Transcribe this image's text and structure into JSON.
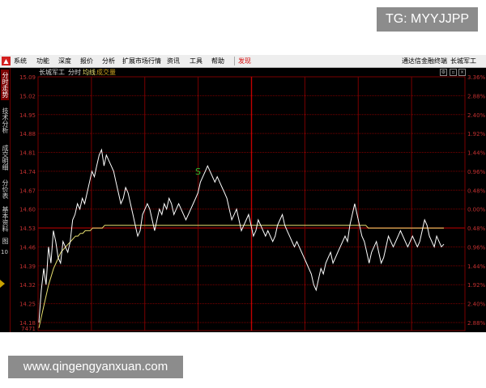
{
  "watermark_top": "TG: MYYJJPP",
  "watermark_bottom": "www.qingengyanxuan.com",
  "menu": {
    "items": [
      "系统",
      "功能",
      "深度",
      "报价",
      "分析",
      "扩展市场行情",
      "资讯",
      "工具",
      "帮助"
    ],
    "discover": "发现",
    "app_name": "通达信金融终端",
    "stock": "长城军工"
  },
  "sidebar": {
    "tabs": [
      "分时走势",
      "技术分析",
      "成交明细",
      "分价表",
      "基本资料",
      "图"
    ],
    "number": "10"
  },
  "chart_header": {
    "stock": "长城军工",
    "mode": "分时",
    "avg_label": "均线",
    "volume_label": "成交量"
  },
  "chart_data": {
    "type": "line",
    "y_labels": [
      "15.09",
      "15.02",
      "14.95",
      "14.88",
      "14.81",
      "14.74",
      "14.67",
      "14.60",
      "14.53",
      "14.46",
      "14.39",
      "14.32",
      "14.25",
      "14.18"
    ],
    "bottom_label": "7471",
    "pct_labels": [
      "3.36%",
      "2.88%",
      "2.40%",
      "1.92%",
      "1.44%",
      "0.96%",
      "0.48%",
      "0.00%",
      "0.48%",
      "0.96%",
      "1.44%",
      "1.92%",
      "2.40%",
      "2.88%"
    ],
    "ylim": [
      14.15,
      15.09
    ],
    "prev_close": 14.53,
    "annotation": "S",
    "colors": {
      "price": "#ffffff",
      "avg": "#e8e070",
      "grid": "#7a0000",
      "axis_text": "#c03030",
      "annotation": "#30c030"
    },
    "series": [
      {
        "values": [
          14.18,
          14.3,
          14.38,
          14.32,
          14.46,
          14.4,
          14.52,
          14.48,
          14.42,
          14.4,
          14.48,
          14.46,
          14.44,
          14.48,
          14.56,
          14.58,
          14.62,
          14.6,
          14.64,
          14.62,
          14.66,
          14.7,
          14.74,
          14.72,
          14.76,
          14.8,
          14.82,
          14.76,
          14.8,
          14.78,
          14.76,
          14.74,
          14.7,
          14.66,
          14.62,
          14.64,
          14.68,
          14.66,
          14.62,
          14.58,
          14.54,
          14.5,
          14.52,
          14.58,
          14.6,
          14.62,
          14.6,
          14.56,
          14.52,
          14.56,
          14.6,
          14.58,
          14.62,
          14.6,
          14.64,
          14.62,
          14.58,
          14.6,
          14.62,
          14.6,
          14.58,
          14.56,
          14.58,
          14.6,
          14.62,
          14.64,
          14.66,
          14.7,
          14.72,
          14.74,
          14.76,
          14.74,
          14.72,
          14.7,
          14.72,
          14.7,
          14.68,
          14.66,
          14.64,
          14.6,
          14.56,
          14.58,
          14.6,
          14.56,
          14.52,
          14.54,
          14.56,
          14.58,
          14.54,
          14.5,
          14.52,
          14.56,
          14.54,
          14.52,
          14.5,
          14.52,
          14.5,
          14.48,
          14.5,
          14.54,
          14.56,
          14.58,
          14.54,
          14.52,
          14.5,
          14.48,
          14.46,
          14.48,
          14.46,
          14.44,
          14.42,
          14.4,
          14.38,
          14.36,
          14.32,
          14.3,
          14.34,
          14.38,
          14.36,
          14.4,
          14.42,
          14.44,
          14.4,
          14.42,
          14.44,
          14.46,
          14.48,
          14.5,
          14.48,
          14.54,
          14.58,
          14.62,
          14.58,
          14.54,
          14.5,
          14.48,
          14.44,
          14.4,
          14.44,
          14.46,
          14.48,
          14.44,
          14.4,
          14.42,
          14.46,
          14.5,
          14.48,
          14.46,
          14.48,
          14.5,
          14.52,
          14.5,
          14.48,
          14.46,
          14.48,
          14.5,
          14.48,
          14.46,
          14.48,
          14.52,
          14.56,
          14.54,
          14.5,
          14.48,
          14.46,
          14.5,
          14.48,
          14.46,
          14.47
        ]
      },
      {
        "values": [
          14.16,
          14.2,
          14.24,
          14.28,
          14.32,
          14.35,
          14.38,
          14.4,
          14.42,
          14.44,
          14.45,
          14.46,
          14.47,
          14.48,
          14.49,
          14.5,
          14.5,
          14.51,
          14.51,
          14.52,
          14.52,
          14.52,
          14.53,
          14.53,
          14.53,
          14.53,
          14.53,
          14.54,
          14.54,
          14.54,
          14.54,
          14.54,
          14.54,
          14.54,
          14.54,
          14.54,
          14.54,
          14.54,
          14.54,
          14.54,
          14.54,
          14.54,
          14.54,
          14.54,
          14.54,
          14.54,
          14.54,
          14.54,
          14.54,
          14.54,
          14.54,
          14.54,
          14.54,
          14.54,
          14.54,
          14.54,
          14.54,
          14.54,
          14.54,
          14.54,
          14.54,
          14.54,
          14.54,
          14.54,
          14.54,
          14.54,
          14.54,
          14.54,
          14.54,
          14.54,
          14.54,
          14.54,
          14.54,
          14.54,
          14.54,
          14.54,
          14.54,
          14.54,
          14.54,
          14.54,
          14.54,
          14.54,
          14.54,
          14.54,
          14.54,
          14.54,
          14.54,
          14.54,
          14.54,
          14.54,
          14.54,
          14.54,
          14.54,
          14.54,
          14.54,
          14.54,
          14.54,
          14.54,
          14.54,
          14.54,
          14.54,
          14.54,
          14.54,
          14.54,
          14.54,
          14.54,
          14.54,
          14.54,
          14.54,
          14.54,
          14.54,
          14.54,
          14.54,
          14.54,
          14.54,
          14.54,
          14.54,
          14.54,
          14.54,
          14.54,
          14.54,
          14.54,
          14.54,
          14.54,
          14.54,
          14.54,
          14.54,
          14.54,
          14.54,
          14.54,
          14.54,
          14.54,
          14.54,
          14.54,
          14.54,
          14.53,
          14.53,
          14.53,
          14.53,
          14.53,
          14.53,
          14.53,
          14.53,
          14.53,
          14.53,
          14.53,
          14.53,
          14.53,
          14.53,
          14.53,
          14.53,
          14.53,
          14.53,
          14.53,
          14.53,
          14.53,
          14.53,
          14.53,
          14.53,
          14.53,
          14.53,
          14.53,
          14.53,
          14.53,
          14.53,
          14.53,
          14.53
        ]
      }
    ]
  }
}
